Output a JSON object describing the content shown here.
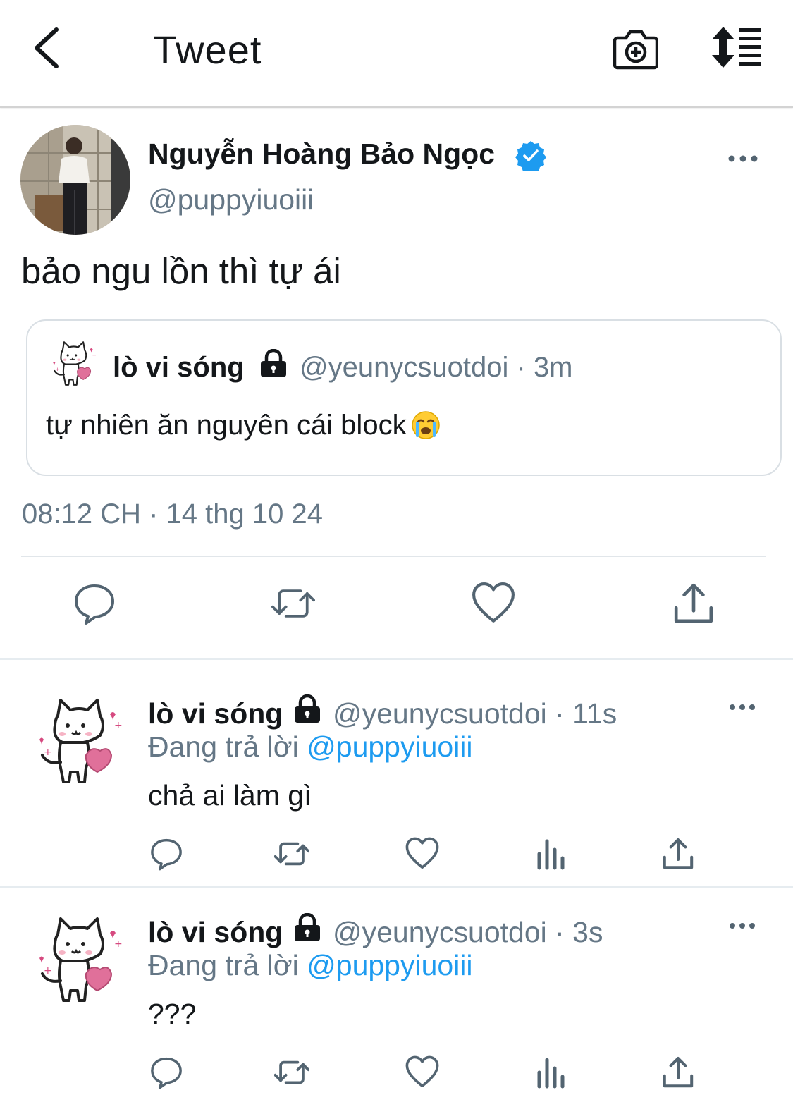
{
  "header": {
    "title": "Tweet"
  },
  "tweet": {
    "author_name": "Nguyễn Hoàng Bảo Ngọc",
    "author_handle": "@puppyiuoiii",
    "text": "bảo ngu lồn thì tự ái",
    "timestamp": "08:12 CH · 14 thg 10 24",
    "quote": {
      "name": "lò vi sóng",
      "handle_time": "@yeunycsuotdoi · 3m",
      "text": "tự nhiên ăn nguyên cái block"
    }
  },
  "replies": [
    {
      "name": "lò vi sóng",
      "handle_time": "@yeunycsuotdoi · 11s",
      "replying_prefix": "Đang trả lời",
      "replying_to": "@puppyiuoiii",
      "text": "chả ai làm gì"
    },
    {
      "name": "lò vi sóng",
      "handle_time": "@yeunycsuotdoi · 3s",
      "replying_prefix": "Đang trả lời",
      "replying_to": "@puppyiuoiii",
      "text": "???"
    }
  ],
  "colors": {
    "accent": "#1d9bf0",
    "secondary_text": "#657786",
    "primary_text": "#14171a",
    "icon": "#536471"
  },
  "icons": [
    "back-arrow-icon",
    "camera-plus-icon",
    "sort-icon",
    "verified-badge-icon",
    "more-icon",
    "lock-icon",
    "reply-icon",
    "retweet-icon",
    "like-icon",
    "share-icon",
    "analytics-icon",
    "loudly-crying-emoji"
  ]
}
